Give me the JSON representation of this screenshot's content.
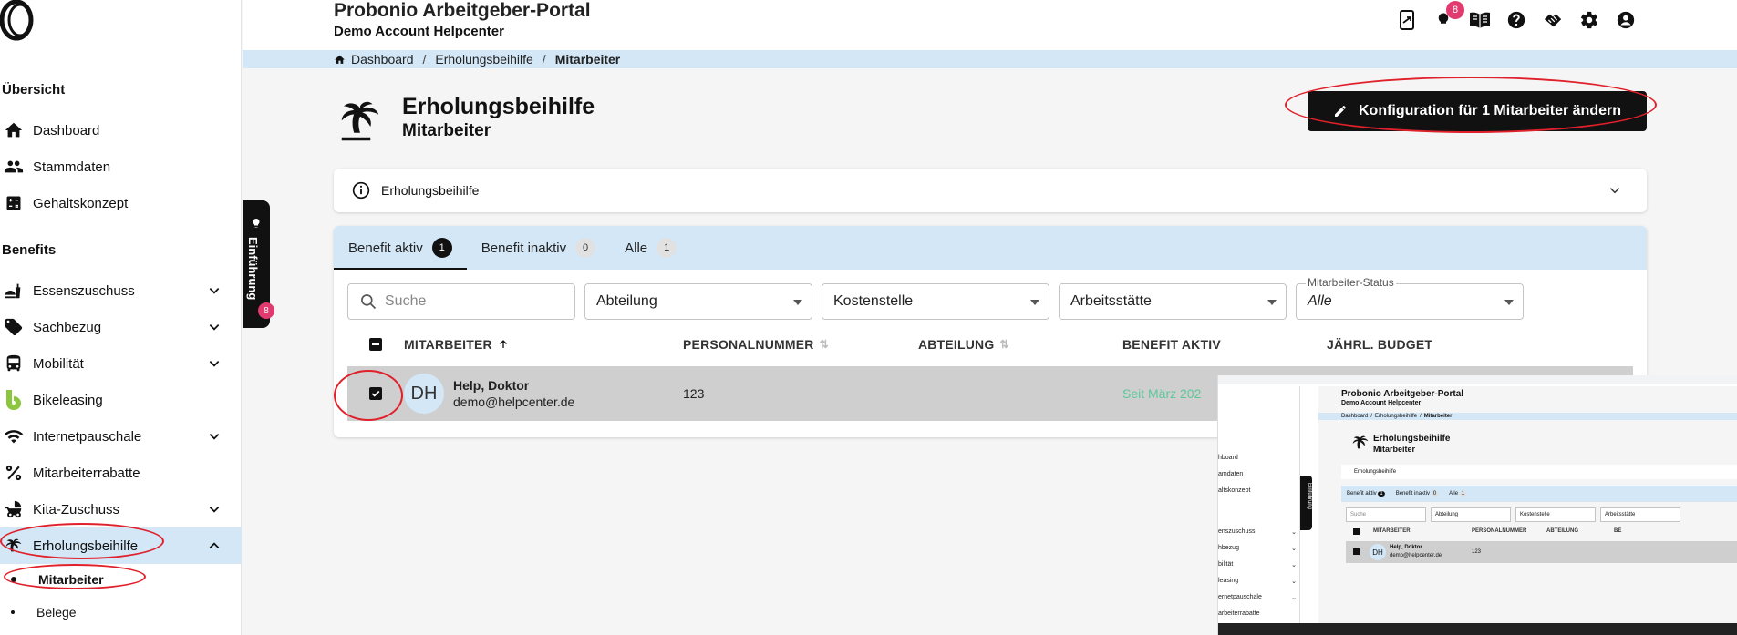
{
  "header": {
    "app_title": "Probonio Arbeitgeber-Portal",
    "app_subtitle": "Demo Account Helpcenter",
    "notification_count": "8",
    "icons": [
      "phone-icon",
      "lightbulb-icon",
      "book-icon",
      "help-icon",
      "handshake-icon",
      "gear-icon",
      "account-icon"
    ]
  },
  "breadcrumb": {
    "items": [
      "Dashboard",
      "Erholungsbeihilfe",
      "Mitarbeiter"
    ],
    "separator": "/"
  },
  "sidebar": {
    "section_overview": "Übersicht",
    "overview_items": [
      {
        "label": "Dashboard",
        "icon": "home-icon"
      },
      {
        "label": "Stammdaten",
        "icon": "people-icon"
      },
      {
        "label": "Gehaltskonzept",
        "icon": "calculator-icon"
      }
    ],
    "section_benefits": "Benefits",
    "benefit_items": [
      {
        "label": "Essenszuschuss",
        "icon": "food-icon"
      },
      {
        "label": "Sachbezug",
        "icon": "tag-icon"
      },
      {
        "label": "Mobilität",
        "icon": "bus-icon"
      },
      {
        "label": "Bikeleasing",
        "icon": "bike-leasing-icon"
      },
      {
        "label": "Internetpauschale",
        "icon": "wifi-icon"
      },
      {
        "label": "Mitarbeiterrabatte",
        "icon": "percent-icon"
      },
      {
        "label": "Kita-Zuschuss",
        "icon": "stroller-icon"
      },
      {
        "label": "Erholungsbeihilfe",
        "icon": "palm-tree-icon"
      }
    ],
    "sub_items": [
      "Mitarbeiter",
      "Belege"
    ],
    "einfuehrung_label": "Einführung",
    "einfuehrung_badge": "8"
  },
  "page": {
    "title": "Erholungsbeihilfe",
    "subtitle": "Mitarbeiter",
    "config_button": "Konfiguration für 1 Mitarbeiter ändern",
    "accordion_label": "Erholungsbeihilfe"
  },
  "tabs": [
    {
      "label": "Benefit aktiv",
      "count": "1"
    },
    {
      "label": "Benefit inaktiv",
      "count": "0"
    },
    {
      "label": "Alle",
      "count": "1"
    }
  ],
  "filters": {
    "search_placeholder": "Suche",
    "abteilung": "Abteilung",
    "kostenstelle": "Kostenstelle",
    "arbeitsstaette": "Arbeitsstätte",
    "status_label": "Mitarbeiter-Status",
    "status_value": "Alle"
  },
  "table": {
    "columns": [
      "MITARBEITER",
      "PERSONALNUMMER",
      "ABTEILUNG",
      "BENEFIT AKTIV",
      "JÄHRL. BUDGET"
    ],
    "rows": [
      {
        "initials": "DH",
        "name": "Help, Doktor",
        "email": "demo@helpcenter.de",
        "personalnummer": "123",
        "abteilung": "",
        "benefit_aktiv": "Seit März 202"
      }
    ]
  },
  "inset": {
    "app_title": "Probonio Arbeitgeber-Portal",
    "app_subtitle": "Demo Account Helpcenter",
    "crumb1": "Dashboard",
    "crumb2": "Erholungsbeihilfe",
    "crumb3": "Mitarbeiter",
    "page_title": "Erholungsbeihilfe",
    "page_subtitle": "Mitarbeiter",
    "accordion": "Erholungsbeihilfe",
    "tab1": "Benefit aktiv",
    "tab1_count": "1",
    "tab2": "Benefit inaktiv",
    "tab2_count": "0",
    "tab3": "Alle",
    "tab3_count": "1",
    "search": "Suche",
    "f1": "Abteilung",
    "f2": "Kostenstelle",
    "f3": "Arbeitsstätte",
    "col1": "MITARBEITER",
    "col2": "PERSONALNUMMER",
    "col3": "ABTEILUNG",
    "col4": "BE",
    "initials": "DH",
    "name": "Help, Doktor",
    "email": "demo@helpcenter.de",
    "pnr": "123",
    "side1": "hboard",
    "side2": "amdaten",
    "side3": "altskonzept",
    "side4": "enszuschuss",
    "side5": "hbezug",
    "side6": "bilität",
    "side7": "leasing",
    "side8": "ernetpauschale",
    "side9": "arbeiterrabatte",
    "einf": "Einführung"
  },
  "colors": {
    "accent_blue": "#d3e7f7",
    "primary": "#111111",
    "badge": "#e03a6f",
    "annotation_red": "#e0202a",
    "success_green": "#5ec79a"
  }
}
